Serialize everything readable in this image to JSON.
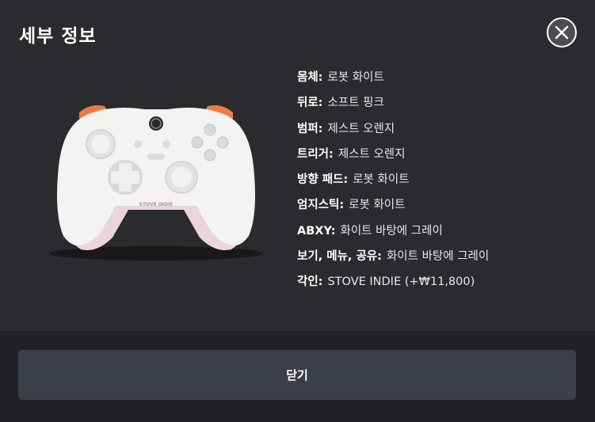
{
  "dialog": {
    "title": "세부 정보",
    "close_icon": "close-icon",
    "close_button_label": "닫기"
  },
  "controller_image": {
    "engraving": "STOVE INDIE",
    "colors": {
      "body": "#f3f3f2",
      "grips": "#ecd9df",
      "bumpers": "#f07a45",
      "dpad": "#e4e4e6"
    }
  },
  "details": [
    {
      "label": "몸체:",
      "value": "로봇 화이트"
    },
    {
      "label": "뒤로:",
      "value": "소프트 핑크"
    },
    {
      "label": "범퍼:",
      "value": "제스트 오렌지"
    },
    {
      "label": "트리거:",
      "value": "제스트 오렌지"
    },
    {
      "label": "방향 패드:",
      "value": "로봇 화이트"
    },
    {
      "label": "엄지스틱:",
      "value": "로봇 화이트"
    },
    {
      "label": "ABXY:",
      "value": "화이트 바탕에 그레이"
    },
    {
      "label": "보기, 메뉴, 공유:",
      "value": "화이트 바탕에 그레이"
    },
    {
      "label": "각인:",
      "value": "STOVE INDIE (+₩11,800)"
    }
  ]
}
